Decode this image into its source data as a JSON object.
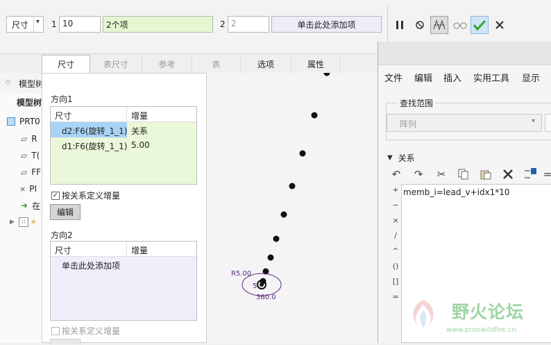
{
  "dashboard": {
    "type_select": "尺寸",
    "dir1_index": "1",
    "dir1_count": "10",
    "dir1_items": "2个项",
    "dir2_index": "2",
    "dir2_count": "2",
    "dir2_add": "单击此处添加项"
  },
  "tabs": [
    "尺寸",
    "表尺寸",
    "参考",
    "表",
    "选项",
    "属性"
  ],
  "panel": {
    "dir1_title": "方向1",
    "col_dim": "尺寸",
    "col_inc": "增量",
    "rows": [
      {
        "dim": "d2:F6(旋转_1_1)",
        "inc": "关系"
      },
      {
        "dim": "d1:F6(旋转_1_1)",
        "inc": "5.00"
      }
    ],
    "define_by_relation": "按关系定义增量",
    "edit_button": "编辑",
    "dir2_title": "方向2",
    "dir2_add": "单击此处添加项",
    "define_by_relation_2": "按关系定义增量"
  },
  "tree": {
    "title": "模型树",
    "subtitle": "模型树",
    "items": [
      "PRT0",
      "R",
      "T(",
      "FF",
      "PI",
      "在"
    ]
  },
  "graphics": {
    "annot_r": "R5.00",
    "annot_5": "5",
    "annot_360": "360.0"
  },
  "relations": {
    "menu": [
      "文件",
      "编辑",
      "插入",
      "实用工具",
      "显示"
    ],
    "scope_label": "查找范围",
    "scope_value": "阵列",
    "section_title": "关系",
    "expression": "memb_i=lead_v+idx1*10",
    "ops": [
      "+",
      "−",
      "×",
      "/",
      "^",
      "()",
      "[]",
      "="
    ]
  },
  "watermark": {
    "name": "野火论坛",
    "url": "www.proewildfire.cn"
  },
  "colors": {
    "selected_row": "#a9d3f5",
    "dir1_bg": "#eaf7d9",
    "dir2_bg": "#f1eefb",
    "ok_green": "#2ea82e"
  }
}
